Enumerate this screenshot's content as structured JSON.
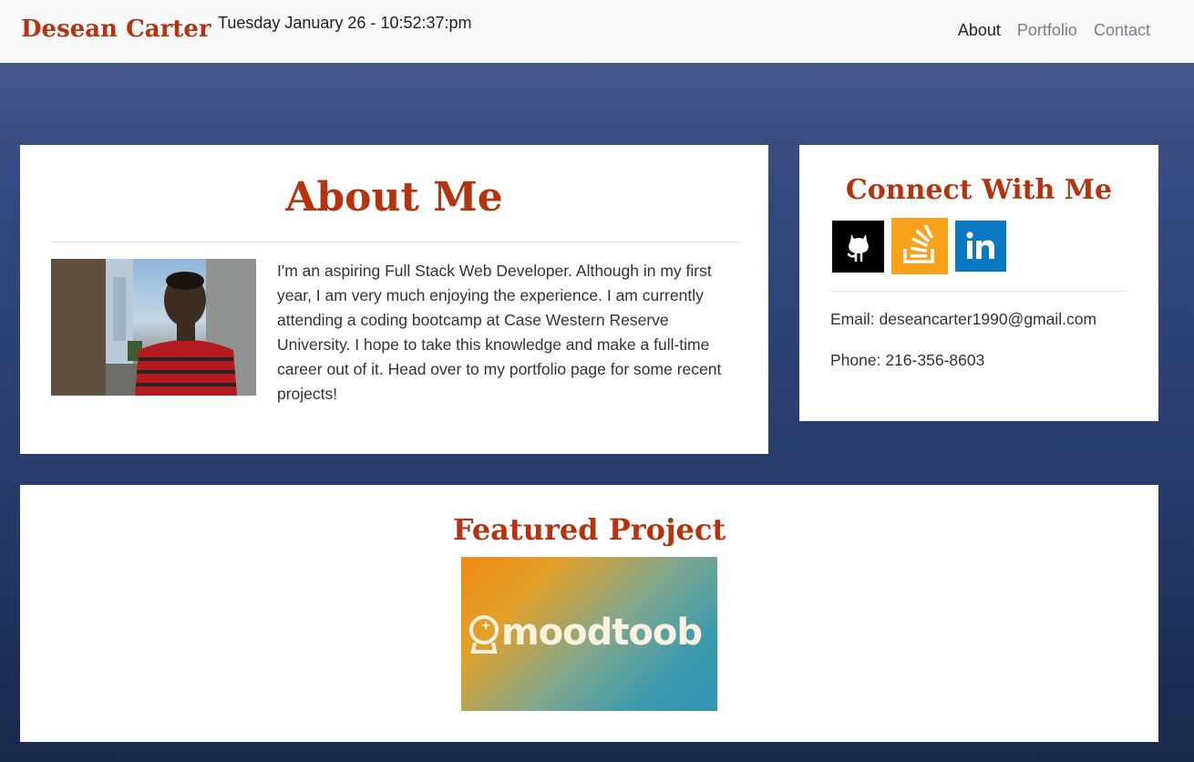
{
  "navbar": {
    "brand": "Desean Carter",
    "clock": "Tuesday January 26 - 10:52:37:pm",
    "links": [
      {
        "label": "About",
        "active": true
      },
      {
        "label": "Portfolio",
        "active": false
      },
      {
        "label": "Contact",
        "active": false
      }
    ]
  },
  "about": {
    "title": "About Me",
    "bio": "I'm an aspiring Full Stack Web Developer. Although in my first year, I am very much enjoying the experience. I am currently attending a coding bootcamp at Case Western Reserve University. I hope to take this knowledge and make a full-time career out of it. Head over to my portfolio page for some recent projects!"
  },
  "connect": {
    "title": "Connect With Me",
    "socials": [
      {
        "icon": "github-icon",
        "color": "#000000"
      },
      {
        "icon": "stackoverflow-icon",
        "color": "#f8a21b"
      },
      {
        "icon": "linkedin-icon",
        "color": "#0b78c2"
      }
    ],
    "email": "Email: deseancarter1990@gmail.com",
    "phone": "Phone: 216-356-8603"
  },
  "featured": {
    "title": "Featured Project",
    "project_name": "moodtoob"
  },
  "colors": {
    "accent": "#b5330f",
    "navbar_bg": "#f8f9fa",
    "page_bg": "#283d6c"
  }
}
